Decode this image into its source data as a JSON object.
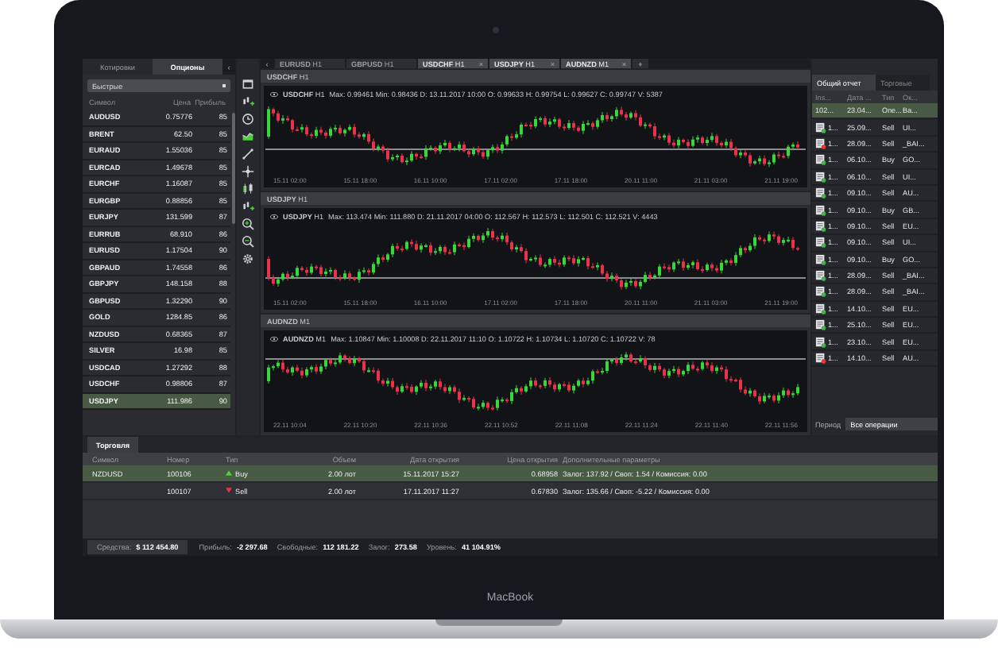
{
  "quotes_panel": {
    "tabs": [
      {
        "label": "Котировки",
        "selected": false
      },
      {
        "label": "Опционы",
        "selected": true
      }
    ],
    "collapse": "‹",
    "filter": "Быстрые",
    "columns": [
      "Символ",
      "Цена",
      "Прибыль"
    ],
    "rows": [
      {
        "symbol": "AUDUSD",
        "price": "0.75776",
        "payout": "85",
        "selected": false
      },
      {
        "symbol": "BRENT",
        "price": "62.50",
        "payout": "85",
        "selected": false
      },
      {
        "symbol": "EURAUD",
        "price": "1.55036",
        "payout": "85",
        "selected": false
      },
      {
        "symbol": "EURCAD",
        "price": "1.49678",
        "payout": "85",
        "selected": false
      },
      {
        "symbol": "EURCHF",
        "price": "1.16087",
        "payout": "85",
        "selected": false
      },
      {
        "symbol": "EURGBP",
        "price": "0.88856",
        "payout": "85",
        "selected": false
      },
      {
        "symbol": "EURJPY",
        "price": "131.599",
        "payout": "87",
        "selected": false
      },
      {
        "symbol": "EURRUB",
        "price": "68.910",
        "payout": "86",
        "selected": false
      },
      {
        "symbol": "EURUSD",
        "price": "1.17504",
        "payout": "90",
        "selected": false
      },
      {
        "symbol": "GBPAUD",
        "price": "1.74558",
        "payout": "86",
        "selected": false
      },
      {
        "symbol": "GBPJPY",
        "price": "148.158",
        "payout": "88",
        "selected": false
      },
      {
        "symbol": "GBPUSD",
        "price": "1.32290",
        "payout": "90",
        "selected": false
      },
      {
        "symbol": "GOLD",
        "price": "1284.85",
        "payout": "86",
        "selected": false
      },
      {
        "symbol": "NZDUSD",
        "price": "0.68365",
        "payout": "87",
        "selected": false
      },
      {
        "symbol": "SILVER",
        "price": "16.98",
        "payout": "85",
        "selected": false
      },
      {
        "symbol": "USDCAD",
        "price": "1.27292",
        "payout": "88",
        "selected": false
      },
      {
        "symbol": "USDCHF",
        "price": "0.98806",
        "payout": "87",
        "selected": false
      },
      {
        "symbol": "USDJPY",
        "price": "111.986",
        "payout": "90",
        "selected": true
      }
    ]
  },
  "chart_tabs": {
    "scroll": "‹",
    "add": "+",
    "tabs": [
      {
        "symbol": "EURUSD",
        "timeframe": "H1",
        "selected": false
      },
      {
        "symbol": "GBPUSD",
        "timeframe": "H1",
        "selected": false
      },
      {
        "symbol": "USDCHF",
        "timeframe": "H1",
        "selected": true,
        "close": "×"
      },
      {
        "symbol": "USDJPY",
        "timeframe": "H1",
        "selected": true,
        "close": "×"
      },
      {
        "symbol": "AUDNZD",
        "timeframe": "M1",
        "selected": true,
        "close": "×"
      }
    ]
  },
  "charts": [
    {
      "title_symbol": "USDCHF",
      "title_timeframe": "H1",
      "legend_symbol": "USDCHF",
      "legend_timeframe": "H1",
      "legend": "Max: 0.99461  Min: 0.98436  D: 13.11.2017 10:00  O: 0.99633  H: 0.99754  L: 0.99627  C: 0.99747  V: 5387",
      "time_labels": [
        "15.11 02:00",
        "15.11 18:00",
        "16.11 10:00",
        "17.11 02:00",
        "17.11 18:00",
        "20.11 11:00",
        "21.11 03:00",
        "21.11 19:00"
      ]
    },
    {
      "title_symbol": "USDJPY",
      "title_timeframe": "H1",
      "legend_symbol": "USDJPY",
      "legend_timeframe": "H1",
      "legend": "Max: 113.474  Min: 111.880  D: 21.11.2017 04:00  O: 112.567  H: 112.573  L: 112.501  C: 112.521  V: 4443",
      "time_labels": [
        "15.11 02:00",
        "15.11 18:00",
        "16.11 10:00",
        "17.11 02:00",
        "17.11 18:00",
        "20.11 11:00",
        "21.11 03:00",
        "21.11 19:00"
      ]
    },
    {
      "title_symbol": "AUDNZD",
      "title_timeframe": "M1",
      "legend_symbol": "AUDNZD",
      "legend_timeframe": "M1",
      "legend": "Max: 1.10847  Min: 1.10008  D: 22.11.2017 11:10  O: 1.10722  H: 1.10734  L: 1.10720  C: 1.10722  V: 78",
      "time_labels": [
        "22.11 10:04",
        "22.11 10:20",
        "22.11 10:36",
        "22.11 10:52",
        "22.11 11:08",
        "22.11 11:24",
        "22.11 11:40",
        "22.11 11:56"
      ]
    }
  ],
  "report_panel": {
    "tabs": [
      {
        "label": "Общий отчет",
        "selected": true
      },
      {
        "label": "Торговые",
        "selected": false
      }
    ],
    "columns": [
      "Ins...",
      "Дата ...",
      "Тип",
      "Ок..."
    ],
    "rows": [
      {
        "id": "102...",
        "date": "23.04...",
        "type": "Опе...",
        "symbol": "Ba...",
        "selected": true
      },
      {
        "id": "1...",
        "date": "25.09...",
        "type": "Sell",
        "symbol": "UI...",
        "selected": false,
        "color": "#4caf50"
      },
      {
        "id": "1...",
        "date": "28.09...",
        "type": "Sell",
        "symbol": "_BAI...",
        "selected": false,
        "color": "#e53935"
      },
      {
        "id": "1...",
        "date": "06.10...",
        "type": "Buy",
        "symbol": "GO...",
        "selected": false,
        "color": "#4caf50"
      },
      {
        "id": "1...",
        "date": "06.10...",
        "type": "Sell",
        "symbol": "UI...",
        "selected": false,
        "color": "#4caf50"
      },
      {
        "id": "1...",
        "date": "09.10...",
        "type": "Sell",
        "symbol": "AU...",
        "selected": false,
        "color": "#4caf50"
      },
      {
        "id": "1...",
        "date": "09.10...",
        "type": "Buy",
        "symbol": "GB...",
        "selected": false,
        "color": "#4caf50"
      },
      {
        "id": "1...",
        "date": "09.10...",
        "type": "Sell",
        "symbol": "EU...",
        "selected": false,
        "color": "#4caf50"
      },
      {
        "id": "1...",
        "date": "09.10...",
        "type": "Sell",
        "symbol": "UI...",
        "selected": false,
        "color": "#4caf50"
      },
      {
        "id": "1...",
        "date": "09.10...",
        "type": "Buy",
        "symbol": "GO...",
        "selected": false,
        "color": "#4caf50"
      },
      {
        "id": "1...",
        "date": "28.09...",
        "type": "Sell",
        "symbol": "_BAI...",
        "selected": false,
        "color": "#4caf50"
      },
      {
        "id": "1...",
        "date": "28.09...",
        "type": "Sell",
        "symbol": "_BAI...",
        "selected": false,
        "color": "#4caf50"
      },
      {
        "id": "1...",
        "date": "14.10...",
        "type": "Sell",
        "symbol": "EU...",
        "selected": false,
        "color": "#4caf50"
      },
      {
        "id": "1...",
        "date": "25.10...",
        "type": "Sell",
        "symbol": "EU...",
        "selected": false,
        "color": "#4caf50"
      },
      {
        "id": "1...",
        "date": "23.10...",
        "type": "Sell",
        "symbol": "EU...",
        "selected": false,
        "color": "#4caf50"
      },
      {
        "id": "1...",
        "date": "14.10...",
        "type": "Sell",
        "symbol": "AU...",
        "selected": false,
        "color": "#e53935"
      }
    ],
    "period_label": "Период",
    "period_value": "Все операции"
  },
  "trades": {
    "tab": "Торговля",
    "columns": [
      "Символ",
      "Номер",
      "Тип",
      "Объем",
      "Дата открытия",
      "Цена открытия",
      "Дополнительные параметры"
    ],
    "rows": [
      {
        "symbol": "NZDUSD",
        "number": "100106",
        "kind": "buy",
        "type": "Buy",
        "volume": "2.00 лот",
        "opened": "15.11.2017 15:27",
        "price": "0.68958",
        "details": "Залог: 137.92 / Своп: 1.54 / Комиссия: 0.00",
        "selected": true
      },
      {
        "number": "100107",
        "kind": "sell",
        "type": "Sell",
        "volume": "2.00 лот",
        "opened": "17.11.2017 11:27",
        "price": "0.67830",
        "details": "Залог: 135.66 / Своп: -5.22 / Комиссия: 0.00",
        "selected": false
      }
    ]
  },
  "status_bar": {
    "equity_label": "Средства:",
    "equity": "$ 112 454.80",
    "items": [
      {
        "label": "Прибыль:",
        "value": "-2 297.68"
      },
      {
        "label": "Свободные:",
        "value": "112 181.22"
      },
      {
        "label": "Залог:",
        "value": "273.58"
      },
      {
        "label": "Уровень:",
        "value": "41 104.91%"
      }
    ]
  },
  "laptop": {
    "brand": "MacBook"
  }
}
